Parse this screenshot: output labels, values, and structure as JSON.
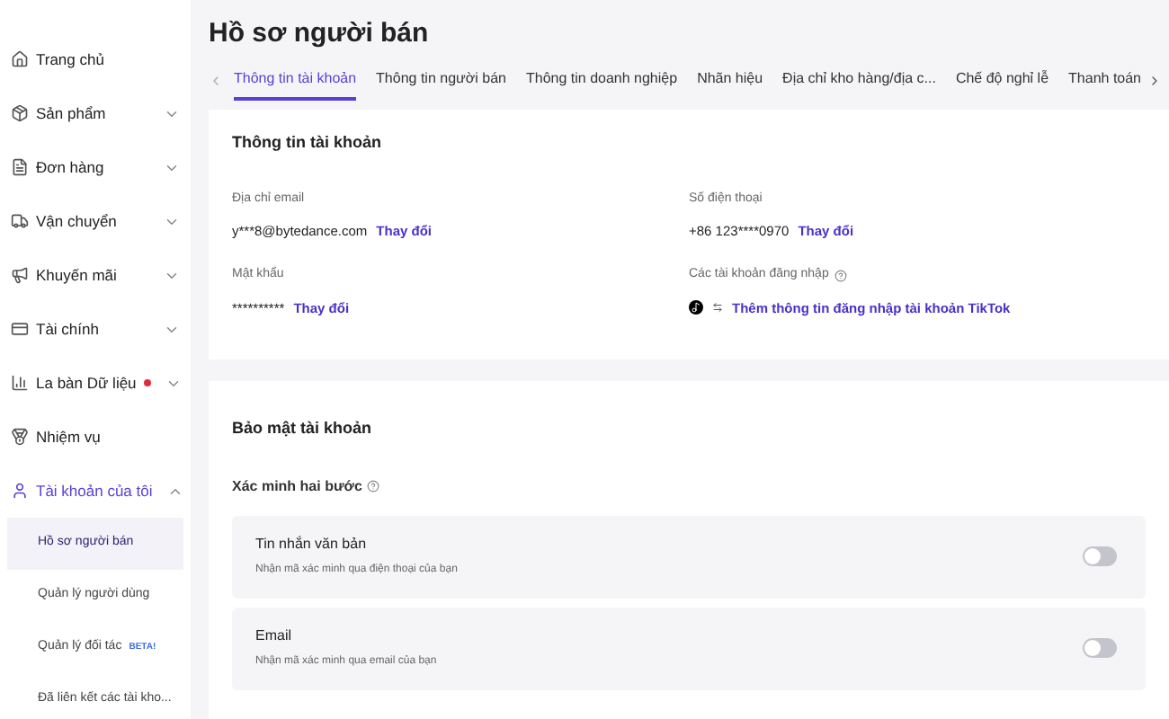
{
  "sidebar": {
    "items": [
      {
        "label": "Trang chủ",
        "kind": "link",
        "selected": false
      },
      {
        "label": "Sản phẩm",
        "kind": "group",
        "expanded": false,
        "selected": false
      },
      {
        "label": "Đơn hàng",
        "kind": "group",
        "expanded": false,
        "selected": false
      },
      {
        "label": "Vận chuyển",
        "kind": "group",
        "expanded": false,
        "selected": false
      },
      {
        "label": "Khuyến mãi",
        "kind": "group",
        "expanded": false,
        "selected": false
      },
      {
        "label": "Tài chính",
        "kind": "group",
        "expanded": false,
        "selected": false
      },
      {
        "label": "La bàn Dữ liệu",
        "kind": "group",
        "expanded": false,
        "dot": true,
        "selected": false
      },
      {
        "label": "Nhiệm vụ",
        "kind": "link",
        "selected": false
      },
      {
        "label": "Tài khoản của tôi",
        "kind": "group",
        "expanded": true,
        "selected": true,
        "children": [
          {
            "label": "Hồ sơ người bán",
            "selected": true
          },
          {
            "label": "Quản lý người dùng",
            "selected": false
          },
          {
            "label": "Quản lý đối tác",
            "badge": "BETA!",
            "selected": false
          },
          {
            "label": "Đã liên kết các tài kho...",
            "selected": false
          }
        ]
      }
    ]
  },
  "page": {
    "title": "Hồ sơ người bán"
  },
  "tabs": [
    {
      "label": "Thông tin tài khoản",
      "selected": true
    },
    {
      "label": "Thông tin người bán",
      "selected": false
    },
    {
      "label": "Thông tin doanh nghiệp",
      "selected": false
    },
    {
      "label": "Nhãn hiệu",
      "selected": false
    },
    {
      "label": "Địa chỉ kho hàng/địa c...",
      "selected": false
    },
    {
      "label": "Chế độ nghỉ lễ",
      "selected": false
    },
    {
      "label": "Thanh toán",
      "selected": false
    }
  ],
  "account_info": {
    "title": "Thông tin tài khoản",
    "fields": [
      {
        "label": "Địa chỉ email",
        "value": "y***8@bytedance.com",
        "action": "Thay đổi"
      },
      {
        "label": "Số điện thoại",
        "value": "+86 123****0970",
        "action": "Thay đổi"
      },
      {
        "label": "Mật khẩu",
        "value": "**********",
        "action": "Thay đổi"
      },
      {
        "label": "Các tài khoản đăng nhập",
        "help": true,
        "link": "Thêm thông tin đăng nhập tài khoản TikTok"
      }
    ]
  },
  "security": {
    "title": "Bảo mật tài khoản",
    "subtitle": "Xác minh hai bước",
    "options": [
      {
        "title": "Tin nhắn văn bản",
        "description": "Nhận mã xác minh qua điện thoại của bạn",
        "on": false
      },
      {
        "title": "Email",
        "description": "Nhận mã xác minh qua email của bạn",
        "on": false
      }
    ]
  }
}
